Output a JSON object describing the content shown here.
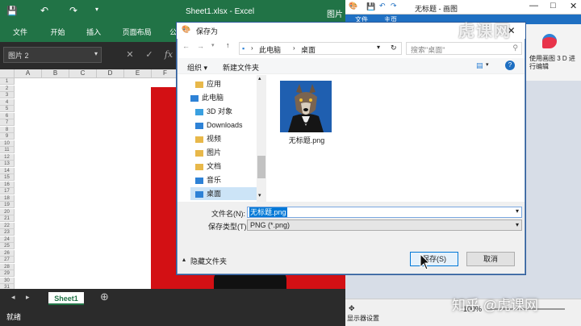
{
  "excel": {
    "title": "Sheet1.xlsx  -  Excel",
    "title_right": "图片",
    "ribbon_tabs": [
      "文件",
      "开始",
      "插入",
      "页面布局",
      "公式"
    ],
    "name_box": "图片 2",
    "fx": "fx",
    "columns": [
      "A",
      "B",
      "C",
      "D",
      "E",
      "F"
    ],
    "rows": [
      "1",
      "2",
      "3",
      "4",
      "5",
      "6",
      "7",
      "8",
      "9",
      "10",
      "11",
      "12",
      "13",
      "14",
      "15",
      "16",
      "17",
      "18",
      "19",
      "20",
      "21",
      "22",
      "23",
      "24",
      "25",
      "26",
      "27",
      "28",
      "29",
      "30",
      "31"
    ],
    "sheet_tab": "Sheet1",
    "status": "就绪"
  },
  "paint": {
    "title": "无标题 - 画图",
    "tab_file": "文件",
    "tab_home": "主页",
    "paint3d_label": "使用画图 3 D 进行编辑",
    "zoom": "100%",
    "status_left": "显示器设置"
  },
  "dialog": {
    "title": "保存为",
    "breadcrumb": [
      "此电脑",
      "桌面"
    ],
    "search_placeholder": "搜索\"桌面\"",
    "organize": "组织 ▾",
    "new_folder": "新建文件夹",
    "nav_items": [
      {
        "label": "应用",
        "icon": "folder-icon"
      },
      {
        "label": "此电脑",
        "icon": "computer-icon"
      },
      {
        "label": "3D 对象",
        "icon": "3d-objects-icon"
      },
      {
        "label": "Downloads",
        "icon": "downloads-icon"
      },
      {
        "label": "视频",
        "icon": "video-icon"
      },
      {
        "label": "图片",
        "icon": "pictures-icon"
      },
      {
        "label": "文档",
        "icon": "documents-icon"
      },
      {
        "label": "音乐",
        "icon": "music-icon"
      },
      {
        "label": "桌面",
        "icon": "desktop-icon"
      }
    ],
    "file": {
      "name": "无标题.png"
    },
    "filename_label": "文件名(N):",
    "filename_value": "无标题.png",
    "filetype_label": "保存类型(T):",
    "filetype_value": "PNG (*.png)",
    "hide_folders": "隐藏文件夹",
    "save": "保存(S)",
    "cancel": "取消"
  },
  "watermark": {
    "logo": "虎课网",
    "zhihu": "知乎 @虎课网"
  },
  "colors": {
    "excel_green": "#217346",
    "dialog_accent": "#0078d7",
    "red_image": "#d31014"
  }
}
